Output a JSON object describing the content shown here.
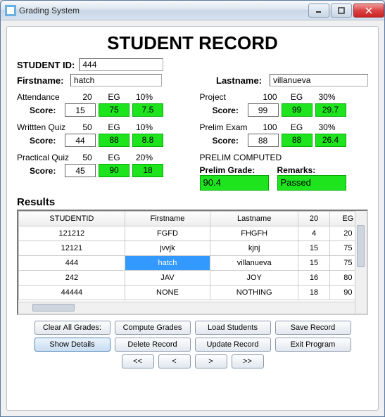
{
  "window_title": "Grading System",
  "heading": "STUDENT RECORD",
  "labels": {
    "student_id": "STUDENT ID:",
    "firstname": "Firstname:",
    "lastname": "Lastname:",
    "score": "Score:",
    "eg": "EG",
    "results": "Results"
  },
  "student": {
    "id": "444",
    "firstname": "hatch",
    "lastname": "villanueva"
  },
  "left_items": [
    {
      "name": "Attendance",
      "max": "20",
      "pct": "10%",
      "score": "15",
      "eg": "75",
      "egw": "7.5"
    },
    {
      "name": "Writtten Quiz",
      "max": "50",
      "pct": "10%",
      "score": "44",
      "eg": "88",
      "egw": "8.8"
    },
    {
      "name": "Practical Quiz",
      "max": "50",
      "pct": "20%",
      "score": "45",
      "eg": "90",
      "egw": "18"
    }
  ],
  "right_items": [
    {
      "name": "Project",
      "max": "100",
      "pct": "30%",
      "score": "99",
      "eg": "99",
      "egw": "29.7"
    },
    {
      "name": "Prelim Exam",
      "max": "100",
      "pct": "30%",
      "score": "88",
      "eg": "88",
      "egw": "26.4"
    }
  ],
  "prelim": {
    "title": "PRELIM COMPUTED",
    "grade_label": "Prelim Grade:",
    "remarks_label": "Remarks:",
    "grade": "90.4",
    "remarks": "Passed"
  },
  "table": {
    "headers": [
      "STUDENTID",
      "Firstname",
      "Lastname",
      "20",
      "EG"
    ],
    "rows": [
      [
        "121212",
        "FGFD",
        "FHGFH",
        "4",
        "20"
      ],
      [
        "12121",
        "jvvjk",
        "kjnj",
        "15",
        "75"
      ],
      [
        "444",
        "hatch",
        "villanueva",
        "15",
        "75"
      ],
      [
        "242",
        "JAV",
        "JOY",
        "16",
        "80"
      ],
      [
        "44444",
        "NONE",
        "NOTHING",
        "18",
        "90"
      ]
    ],
    "selected_row": 2,
    "selected_col": 1
  },
  "buttons": {
    "clear": "Clear All Grades:",
    "compute": "Compute Grades",
    "load": "Load Students",
    "save": "Save Record",
    "show": "Show Details",
    "delete": "Delete Record",
    "update": "Update Record",
    "exit": "Exit Program",
    "first": "<<",
    "prev": "<",
    "next": ">",
    "last": ">>"
  }
}
